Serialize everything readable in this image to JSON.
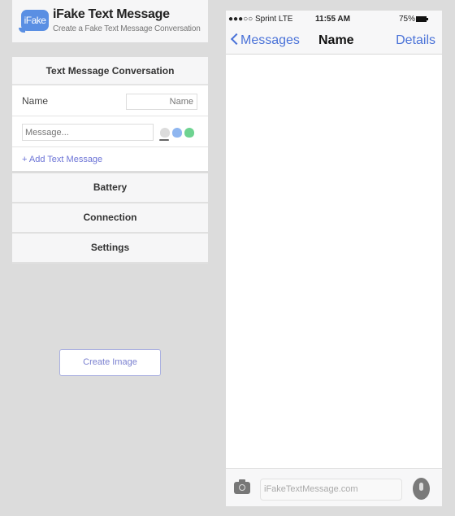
{
  "app": {
    "logo_text": "iFake",
    "title": "iFake Text Message",
    "subtitle": "Create a Fake Text Message Conversation"
  },
  "conversation": {
    "heading": "Text Message Conversation",
    "name_label": "Name",
    "name_placeholder": "Name",
    "message_placeholder": "Message...",
    "bubble_colors": {
      "gray": "#dcdcdc",
      "blue": "#8fb6f0",
      "green": "#6ed391"
    },
    "add_link": "+ Add Text Message"
  },
  "sections": [
    {
      "label": "Battery"
    },
    {
      "label": "Connection"
    },
    {
      "label": "Settings"
    }
  ],
  "create_button": "Create Image",
  "phone": {
    "carrier": "●●●○○ Sprint  LTE",
    "time": "11:55 AM",
    "battery_pct": "75%",
    "back_label": "Messages",
    "nav_title": "Name",
    "details_label": "Details",
    "input_placeholder": "iFakeTextMessage.com"
  },
  "colors": {
    "accent": "#4a72d8",
    "link": "#6c74d6"
  }
}
